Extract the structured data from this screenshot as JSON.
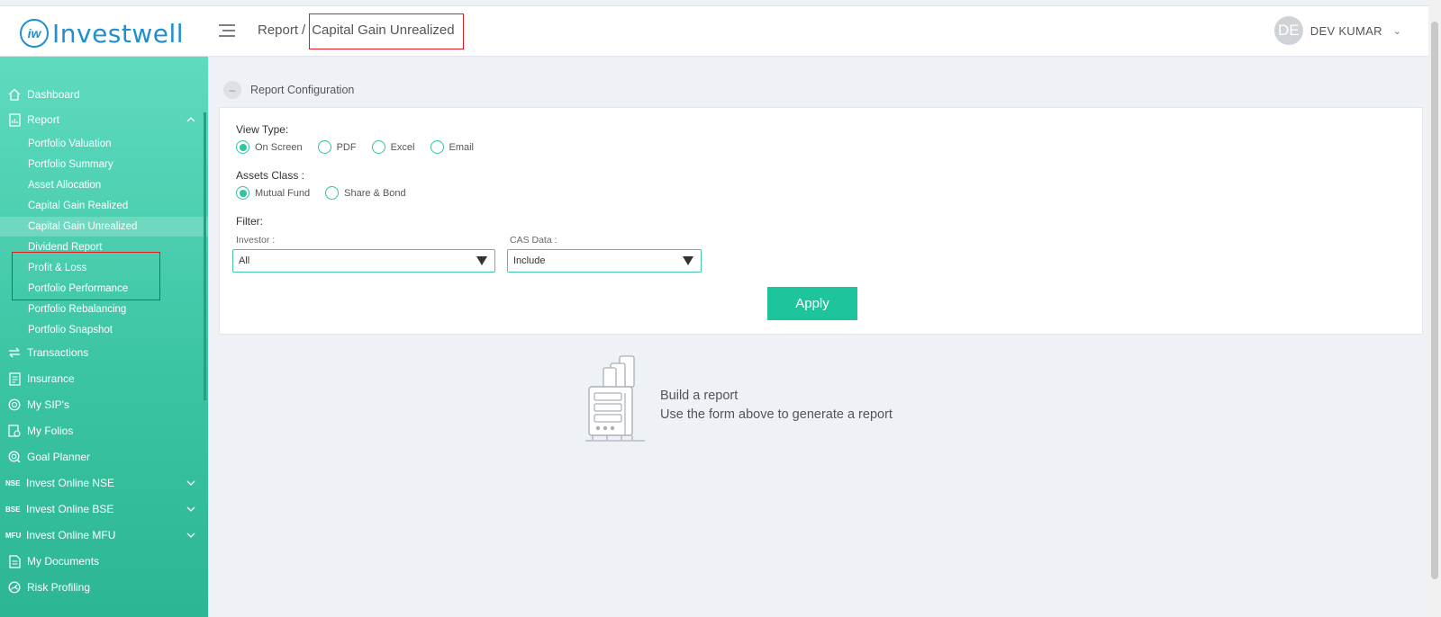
{
  "header": {
    "logo_text": "Investwell",
    "logo_mark": "iw",
    "breadcrumb_root": "Report",
    "breadcrumb_sep": "/",
    "breadcrumb_current": "Capital Gain Unrealized",
    "user_initials": "DE",
    "user_name": "DEV KUMAR"
  },
  "sidebar": {
    "items": [
      {
        "label": "Dashboard",
        "icon": "home-icon"
      },
      {
        "label": "Report",
        "icon": "report-icon"
      },
      {
        "label": "Transactions",
        "icon": "transfer-icon"
      },
      {
        "label": "Insurance",
        "icon": "insurance-icon"
      },
      {
        "label": "My SIP's",
        "icon": "sip-icon"
      },
      {
        "label": "My Folios",
        "icon": "folios-icon"
      },
      {
        "label": "Goal Planner",
        "icon": "goal-icon"
      },
      {
        "label": "Invest Online NSE",
        "tag": "NSE"
      },
      {
        "label": "Invest Online BSE",
        "tag": "BSE"
      },
      {
        "label": "Invest Online MFU",
        "tag": "MFU"
      },
      {
        "label": "My Documents",
        "icon": "document-icon"
      },
      {
        "label": "Risk Profiling",
        "icon": "risk-icon"
      }
    ],
    "report_sub": [
      "Portfolio Valuation",
      "Portfolio Summary",
      "Asset Allocation",
      "Capital Gain Realized",
      "Capital Gain Unrealized",
      "Dividend Report",
      "Profit & Loss",
      "Portfolio Performance",
      "Portfolio Rebalancing",
      "Portfolio Snapshot"
    ],
    "active_sub": "Capital Gain Unrealized"
  },
  "config": {
    "section_title": "Report Configuration",
    "collapse_symbol": "–",
    "view_type_label": "View Type:",
    "view_types": [
      "On Screen",
      "PDF",
      "Excel",
      "Email"
    ],
    "view_type_selected": "On Screen",
    "assets_class_label": "Assets Class :",
    "assets_classes": [
      "Mutual Fund",
      "Share & Bond"
    ],
    "assets_class_selected": "Mutual Fund",
    "filter_label": "Filter:",
    "investor_label": "Investor :",
    "investor_value": "All",
    "cas_label": "CAS Data :",
    "cas_value": "Include",
    "apply_label": "Apply"
  },
  "empty_state": {
    "title": "Build a report",
    "subtitle": "Use the form above to generate a report"
  },
  "colors": {
    "accent": "#1ec59c",
    "brand": "#1f8fce",
    "highlight": "#e01b24"
  }
}
